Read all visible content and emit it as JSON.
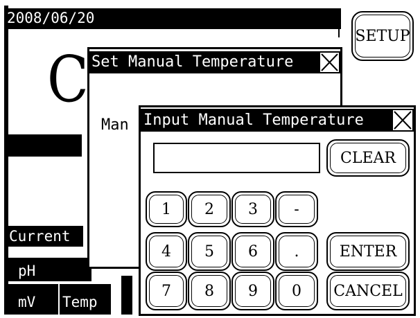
{
  "status_bar": {
    "date": "2008/06/20"
  },
  "setup_button": {
    "label": "SETUP"
  },
  "background": {
    "big_char": "C",
    "current_label": "Current",
    "tab_ph": "pH",
    "tab_mv": "mV",
    "tab_temp": "Temp"
  },
  "set_dialog": {
    "title": "Set Manual Temperature",
    "field_label_partial": "Man"
  },
  "input_dialog": {
    "title": "Input Manual Temperature",
    "input_value": "",
    "clear_label": "CLEAR",
    "enter_label": "ENTER",
    "cancel_label": "CANCEL",
    "keys": {
      "k1": "1",
      "k2": "2",
      "k3": "3",
      "kminus": "-",
      "k4": "4",
      "k5": "5",
      "k6": "6",
      "kdot": ".",
      "k7": "7",
      "k8": "8",
      "k9": "9",
      "k0": "0"
    }
  },
  "colors": {
    "background": "#ffffff",
    "foreground": "#000000"
  }
}
